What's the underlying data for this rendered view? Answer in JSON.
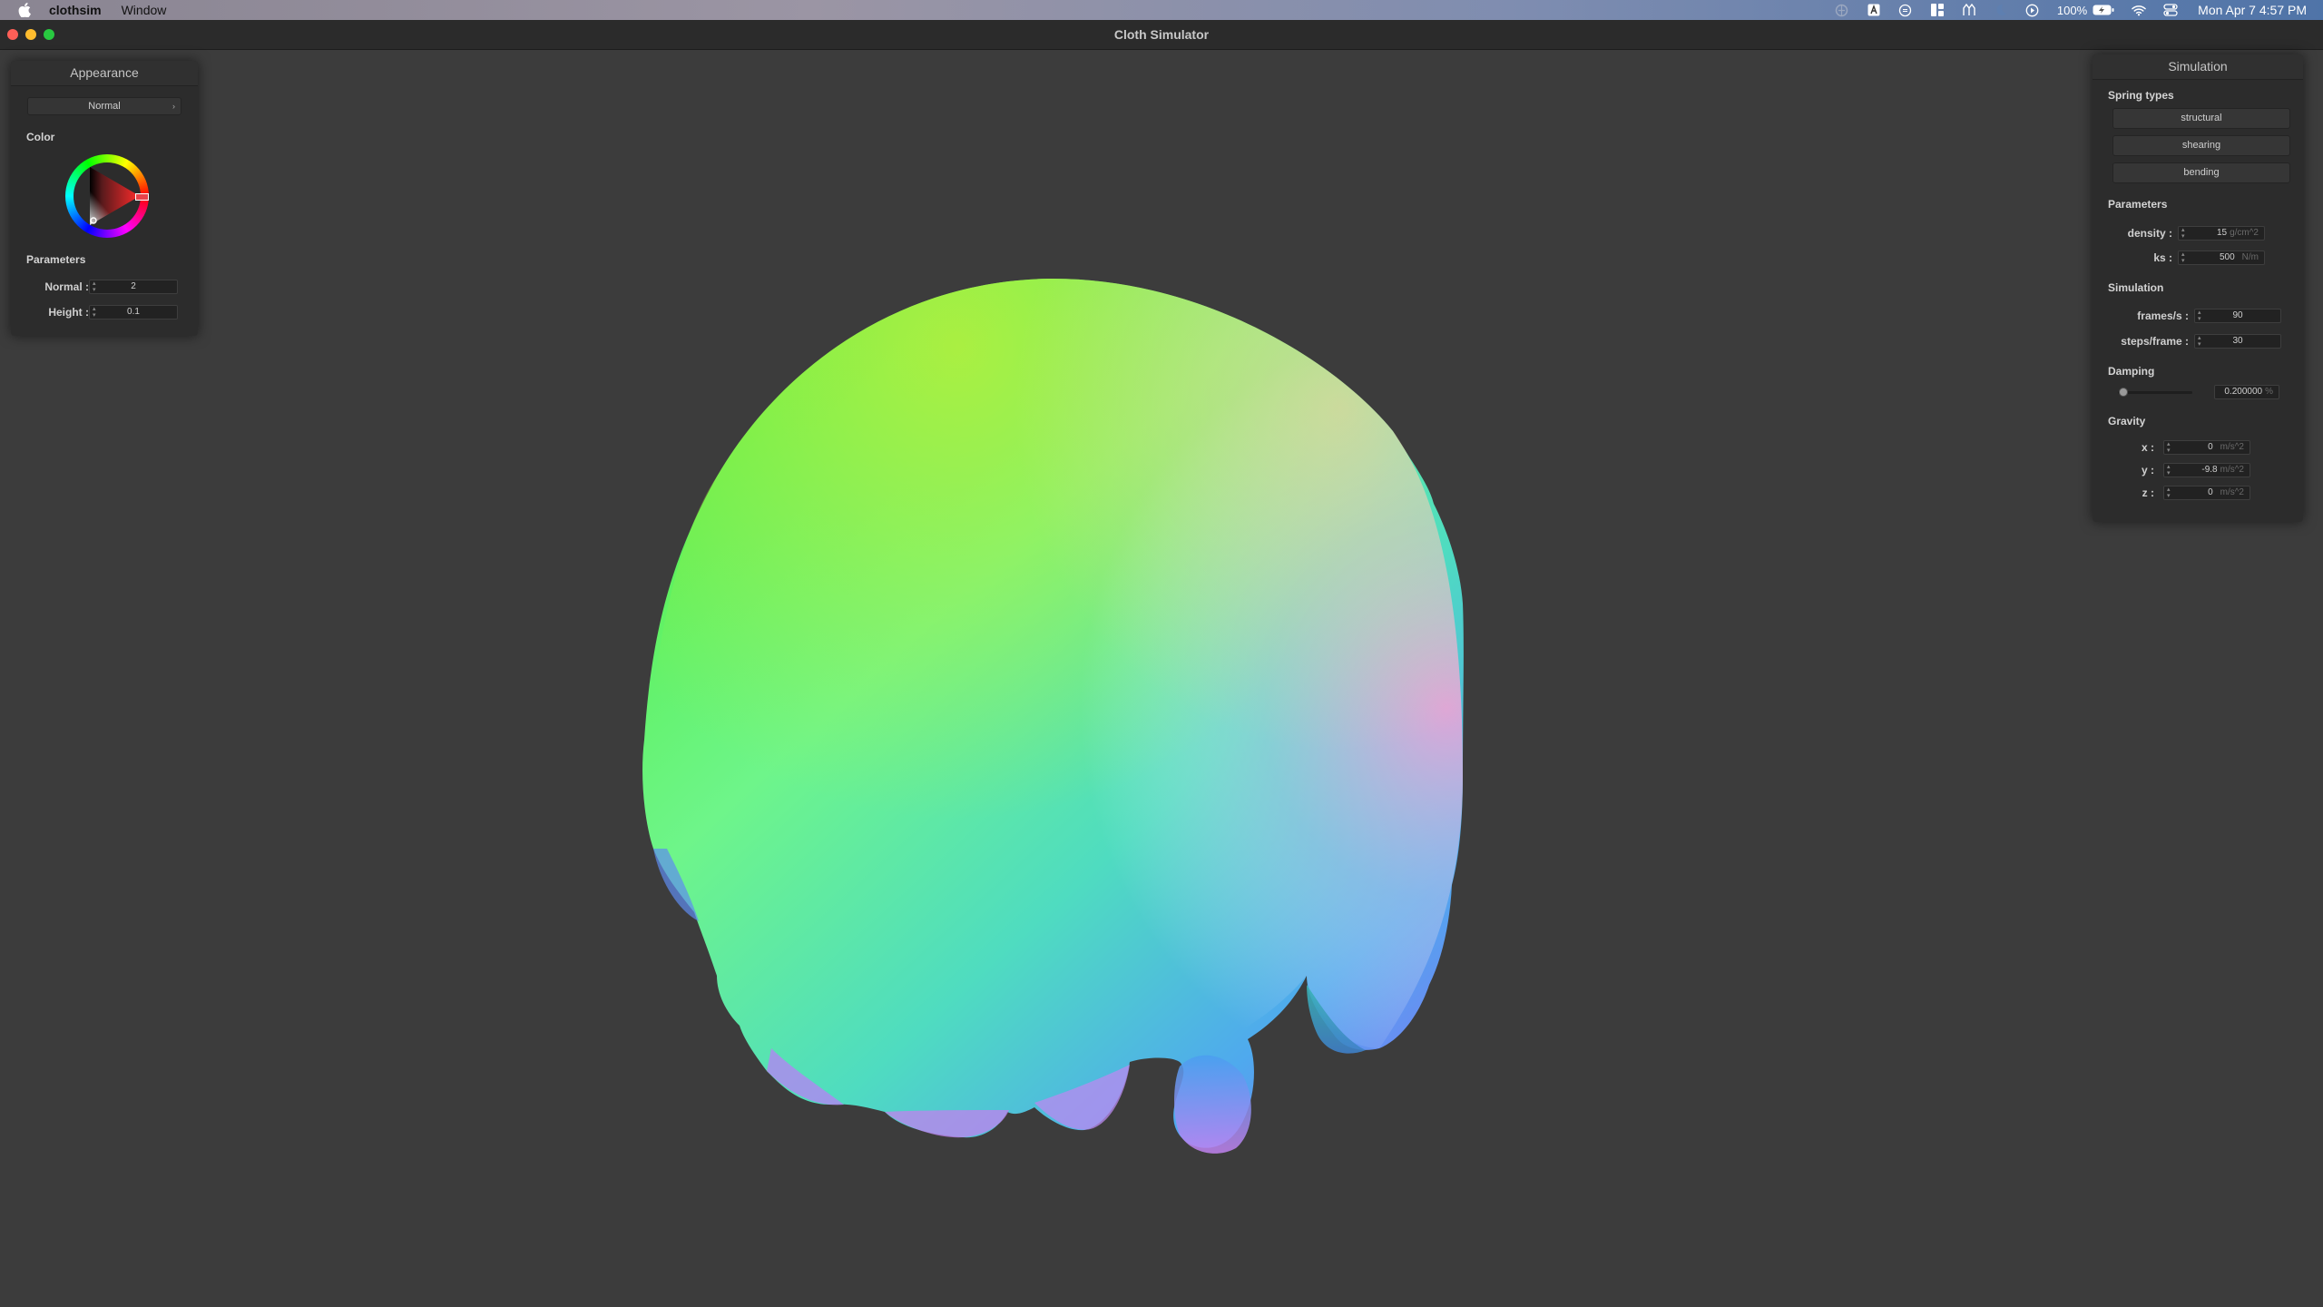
{
  "menubar": {
    "app_name": "clothsim",
    "menu_window": "Window",
    "battery_percent": "100%",
    "clock": "Mon Apr 7  4:57 PM",
    "status_icons": [
      "vpn-icon",
      "text-input-icon",
      "focus-icon",
      "stage-manager-icon",
      "activity-icon",
      "moon-icon",
      "play-icon",
      "battery-icon",
      "wifi-icon",
      "control-center-icon"
    ]
  },
  "window": {
    "title": "Cloth Simulator"
  },
  "appearance_panel": {
    "title": "Appearance",
    "shader_selected": "Normal",
    "color_label": "Color",
    "parameters_label": "Parameters",
    "normal_label": "Normal :",
    "normal_value": "2",
    "height_label": "Height :",
    "height_value": "0.1",
    "selected_color": "#e8434a"
  },
  "simulation_panel": {
    "title": "Simulation",
    "spring_types_label": "Spring types",
    "spring_types": [
      "structural",
      "shearing",
      "bending"
    ],
    "parameters_label": "Parameters",
    "density_label": "density :",
    "density_value": "15",
    "density_unit": "g/cm^2",
    "ks_label": "ks :",
    "ks_value": "500",
    "ks_unit": "N/m",
    "simulation_label": "Simulation",
    "fps_label": "frames/s :",
    "fps_value": "90",
    "steps_label": "steps/frame :",
    "steps_value": "30",
    "damping_label": "Damping",
    "damping_value": "0.200000",
    "damping_unit": "%",
    "damping_fraction": 0.02,
    "gravity_label": "Gravity",
    "gravity_x_label": "x :",
    "gravity_x_value": "0",
    "gravity_y_label": "y :",
    "gravity_y_value": "-9.8",
    "gravity_z_label": "z :",
    "gravity_z_value": "0",
    "gravity_unit": "m/s^2"
  }
}
